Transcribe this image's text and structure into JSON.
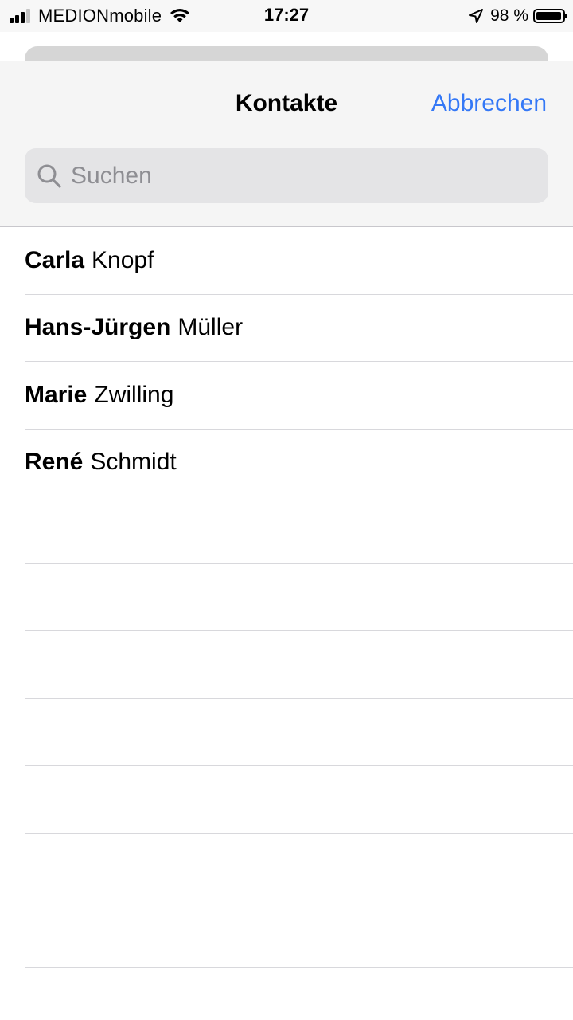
{
  "status_bar": {
    "carrier": "MEDIONmobile",
    "time": "17:27",
    "battery_percent": "98 %",
    "battery_level": 0.98,
    "signal_bars": 3,
    "signal_icon": "cellular-signal-icon",
    "wifi_icon": "wifi-icon",
    "location_icon": "location-arrow-icon",
    "battery_icon": "battery-icon"
  },
  "header": {
    "title": "Kontakte",
    "cancel_label": "Abbrechen",
    "accent_color": "#3478f6"
  },
  "search": {
    "placeholder": "Suchen",
    "value": "",
    "icon": "search-icon"
  },
  "contacts": [
    {
      "first": "Carla",
      "last": "Knopf"
    },
    {
      "first": "Hans-Jürgen",
      "last": "Müller"
    },
    {
      "first": "Marie",
      "last": "Zwilling"
    },
    {
      "first": "René",
      "last": "Schmidt"
    }
  ],
  "empty_rows": 7
}
